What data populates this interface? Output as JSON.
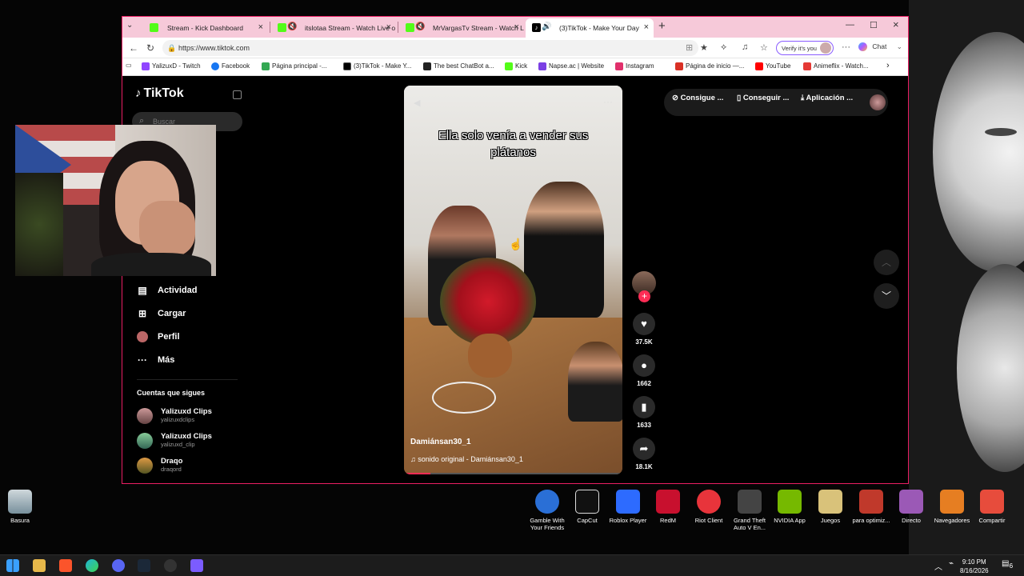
{
  "browser": {
    "tabs": [
      {
        "title": "Stream - Kick Dashboard",
        "color": "#53fc18"
      },
      {
        "title": "itslotaa Stream - Watch Live o",
        "color": "#53fc18"
      },
      {
        "title": "MrVargasTv Stream - Watch L",
        "color": "#53fc18"
      },
      {
        "title": "(3)TikTok - Make Your Day",
        "color": "#000000"
      }
    ],
    "url": "https://www.tiktok.com",
    "verify_label": "Verify it's you",
    "chat_label": "Chat",
    "bookmarks": [
      {
        "label": "YalizuxD - Twitch",
        "color": "#9146ff"
      },
      {
        "label": "Facebook",
        "color": "#1877f2"
      },
      {
        "label": "Página principal -...",
        "color": "#34a853"
      },
      {
        "label": "(3)TikTok - Make Y...",
        "color": "#000000"
      },
      {
        "label": "The best ChatBot a...",
        "color": "#222222"
      },
      {
        "label": "Kick",
        "color": "#53fc18"
      },
      {
        "label": "Napse.ac | Website",
        "color": "#7b3fe4"
      },
      {
        "label": "Instagram",
        "color": "#e1306c"
      },
      {
        "label": "Página de inicio —...",
        "color": "#d93025"
      },
      {
        "label": "YouTube",
        "color": "#ff0000"
      },
      {
        "label": "Animeflix - Watch...",
        "color": "#e53935"
      }
    ]
  },
  "tiktok": {
    "logo": "TikTok",
    "search_placeholder": "Buscar",
    "nav": [
      {
        "label": "Actividad",
        "icon": "inbox-icon"
      },
      {
        "label": "Cargar",
        "icon": "upload-icon"
      },
      {
        "label": "Perfil",
        "icon": "profile-icon"
      },
      {
        "label": "Más",
        "icon": "more-icon"
      }
    ],
    "following_title": "Cuentas que sigues",
    "following": [
      {
        "name": "Yalizuxd Clips",
        "handle": "yalizuxdclips"
      },
      {
        "name": "Yalizuxd Clips",
        "handle": "yalizuxd_clip"
      },
      {
        "name": "Draqo",
        "handle": "draqord"
      }
    ],
    "topbar": [
      "Consigue ...",
      "Conseguir ...",
      "Aplicación ..."
    ],
    "video": {
      "caption_line1": "Ella solo venía a vender sus",
      "caption_line2": "plátanos",
      "author": "Damiánsan30_1",
      "sound": "sonido original - Damiánsan30_1",
      "progress": 0.12
    },
    "actions": {
      "likes": "37.5K",
      "comments": "1662",
      "saves": "1633",
      "shares": "18.1K"
    }
  },
  "desktop": {
    "icons": [
      {
        "label": "Basura",
        "color": "#9ab"
      },
      {
        "label": "Gamble With Your Friends",
        "color": "#2a6fd6"
      },
      {
        "label": "CapCut",
        "color": "#111"
      },
      {
        "label": "Roblox Player",
        "color": "#2d6bff"
      },
      {
        "label": "RedM",
        "color": "#c8102e"
      },
      {
        "label": "Riot Client",
        "color": "#e8343b"
      },
      {
        "label": "Grand Theft Auto V En...",
        "color": "#444"
      },
      {
        "label": "NVIDIA App",
        "color": "#76b900"
      },
      {
        "label": "Juegos",
        "color": "#d9c27a"
      },
      {
        "label": "para optimiz...",
        "color": "#c0392b"
      },
      {
        "label": "Directo",
        "color": "#9b59b6"
      },
      {
        "label": "Navegadores",
        "color": "#e67e22"
      },
      {
        "label": "Compartir",
        "color": "#e74c3c"
      }
    ]
  },
  "taskbar": {
    "time": "9:10 PM",
    "date": "8/16/2026",
    "notif": "6"
  }
}
